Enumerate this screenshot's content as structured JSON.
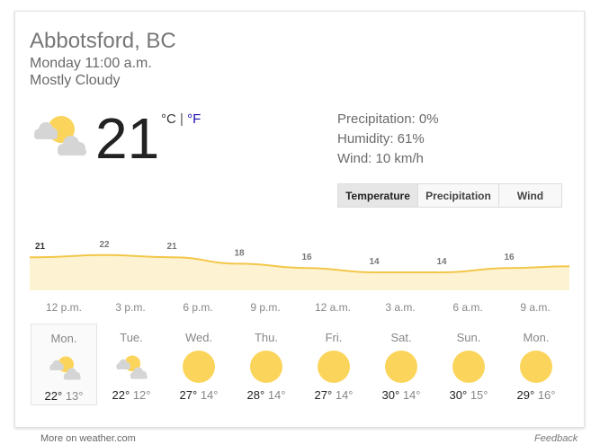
{
  "location": "Abbotsford, BC",
  "datetime": "Monday 11:00 a.m.",
  "condition": "Mostly Cloudy",
  "current": {
    "temp": "21",
    "unit_c": "°C",
    "unit_sep": " | ",
    "unit_f": "°F",
    "icon": "partly-cloudy-icon"
  },
  "stats": {
    "precipitation": "Precipitation: 0%",
    "humidity": "Humidity: 61%",
    "wind": "Wind: 10 km/h"
  },
  "tabs": [
    "Temperature",
    "Precipitation",
    "Wind"
  ],
  "active_tab": "Temperature",
  "hourly": {
    "values": [
      21,
      22,
      21,
      18,
      16,
      14,
      14,
      16
    ],
    "labels": [
      "12 p.m.",
      "3 p.m.",
      "6 p.m.",
      "9 p.m.",
      "12 a.m.",
      "3 a.m.",
      "6 a.m.",
      "9 a.m."
    ]
  },
  "days": [
    {
      "name": "Mon.",
      "hi": "22°",
      "lo": "13°",
      "icon": "partly-cloudy-icon"
    },
    {
      "name": "Tue.",
      "hi": "22°",
      "lo": "12°",
      "icon": "partly-cloudy-icon"
    },
    {
      "name": "Wed.",
      "hi": "27°",
      "lo": "14°",
      "icon": "sun-icon"
    },
    {
      "name": "Thu.",
      "hi": "28°",
      "lo": "14°",
      "icon": "sun-icon"
    },
    {
      "name": "Fri.",
      "hi": "27°",
      "lo": "14°",
      "icon": "sun-icon"
    },
    {
      "name": "Sat.",
      "hi": "30°",
      "lo": "14°",
      "icon": "sun-icon"
    },
    {
      "name": "Sun.",
      "hi": "30°",
      "lo": "15°",
      "icon": "sun-icon"
    },
    {
      "name": "Mon.",
      "hi": "29°",
      "lo": "16°",
      "icon": "sun-icon"
    }
  ],
  "selected_day": 0,
  "footer": {
    "more": "More on weather.com",
    "feedback": "Feedback"
  },
  "colors": {
    "sun": "#fbd55b",
    "cloud": "#d5d5d5",
    "graph_line": "#f3c74a",
    "graph_fill": "#fdf3d3",
    "link": "#1a0dab"
  }
}
